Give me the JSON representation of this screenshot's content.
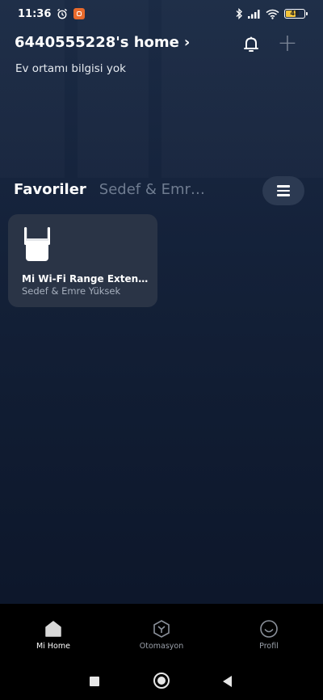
{
  "status_bar": {
    "time": "11:36",
    "battery": "48"
  },
  "header": {
    "home_title": "6440555228's home",
    "chevron": "›",
    "subtitle": "Ev ortamı bilgisi yok",
    "add_label": "+"
  },
  "tabs": [
    {
      "label": "Favoriler",
      "active": true
    },
    {
      "label": "Sedef & Emr…",
      "active": false
    }
  ],
  "devices": [
    {
      "name": "Mi Wi-Fi Range Exten…",
      "room": "Sedef & Emre Yüksek"
    }
  ],
  "bottom_nav": [
    {
      "label": "Mi Home",
      "icon": "home-icon",
      "active": true
    },
    {
      "label": "Otomasyon",
      "icon": "automation-icon",
      "active": false
    },
    {
      "label": "Profil",
      "icon": "profile-icon",
      "active": false
    }
  ],
  "colors": {
    "background": "#16243d",
    "card": "#2a3446",
    "inactive_text": "#6f7c90",
    "notification_app": "#e86a2c",
    "battery": "#f5c43a"
  }
}
